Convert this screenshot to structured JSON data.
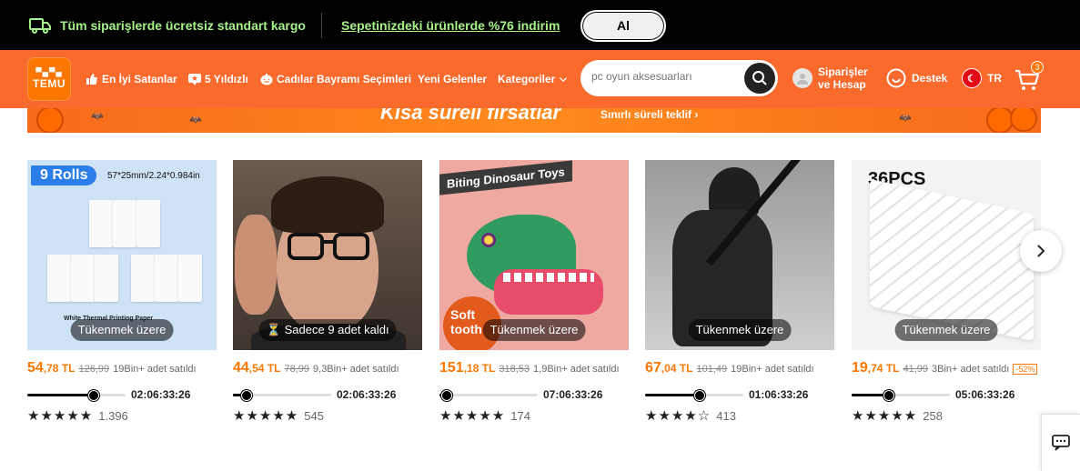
{
  "promo": {
    "shipping_text": "Tüm siparişlerde ücretsiz standart kargo",
    "discount_link": "Sepetinizdeki ürünlerde %76 indirim",
    "al_button": "Al"
  },
  "header": {
    "logo_icons": "▀▄▀▄",
    "logo_text": "TEMU",
    "nav": [
      {
        "label": "En İyi Satanlar",
        "icon": "thumbs-up-icon"
      },
      {
        "label": "5 Yıldızlı",
        "icon": "star-badge-icon"
      },
      {
        "label": "Cadılar Bayramı Seçimleri",
        "icon": "pumpkin-icon"
      },
      {
        "label": "Yeni Gelenler",
        "icon": ""
      },
      {
        "label": "Kategoriler",
        "icon": "chevron-down-icon"
      }
    ],
    "search_placeholder": "pc oyun aksesuarları",
    "account_line1": "Siparişler",
    "account_line2": "ve Hesap",
    "support": "Destek",
    "lang": "TR",
    "cart_count": "3"
  },
  "banner": {
    "title": "Kısa süreli fırsatlar",
    "offer": "Sınırlı süreli teklif"
  },
  "products": [
    {
      "name": "9 Rolls thermal printing paper",
      "badge": "9 Rolls",
      "img_label": "57*25mm/2.24*0.984in",
      "img_caption": "White Thermal Printing Paper",
      "stock": "Tükenmek üzere",
      "price_main": "54",
      "price_frac": ",78 TL",
      "price_old": "126,99",
      "sold": "19Bin+ adet satıldı",
      "discount": "",
      "progress": 0.62,
      "time": "02:06:33:26",
      "stars": "★★★★★",
      "rating": 4.9,
      "reviews": "1.396"
    },
    {
      "name": "Glasses",
      "badge": "",
      "img_label": "",
      "img_caption": "",
      "stock": "Sadece 9 adet kaldı",
      "price_main": "44",
      "price_frac": ",54 TL",
      "price_old": "78,99",
      "sold": "9,3Bin+ adet satıldı",
      "discount": "",
      "progress": 0.08,
      "time": "02:06:33:26",
      "stars": "★★★★★",
      "rating": 4.5,
      "reviews": "545"
    },
    {
      "name": "Biting Dinosaur Toys",
      "badge": "Biting Dinosaur Toys",
      "img_label": "Soft tooth",
      "img_caption": "",
      "stock": "Tükenmek üzere",
      "price_main": "151",
      "price_frac": ",18 TL",
      "price_old": "318,53",
      "sold": "1,9Bin+ adet satıldı",
      "discount": "",
      "progress": 0.02,
      "time": "07:06:33:26",
      "stars": "★★★★★",
      "rating": 4.8,
      "reviews": "174"
    },
    {
      "name": "Ninja costume",
      "badge": "",
      "img_label": "",
      "img_caption": "",
      "stock": "Tükenmek üzere",
      "price_main": "67",
      "price_frac": ",04 TL",
      "price_old": "101,49",
      "sold": "19Bin+ adet satıldı",
      "discount": "",
      "progress": 0.5,
      "time": "01:06:33:26",
      "stars": "★★★★☆",
      "rating": 3.5,
      "reviews": "413"
    },
    {
      "name": "36PCS white sticks",
      "badge": "36PCS",
      "img_label": "",
      "img_caption": "",
      "stock": "Tükenmek üzere",
      "price_main": "19",
      "price_frac": ",74 TL",
      "price_old": "41,99",
      "sold": "3Bin+ adet satıldı",
      "discount": "-52%",
      "progress": 0.32,
      "time": "05:06:33:26",
      "stars": "★★★★★",
      "rating": 4.5,
      "reviews": "258"
    }
  ],
  "colors": {
    "accent_orange": "#fb7701",
    "header_orange": "#fb6a2d",
    "promo_green": "#a6f28a"
  }
}
